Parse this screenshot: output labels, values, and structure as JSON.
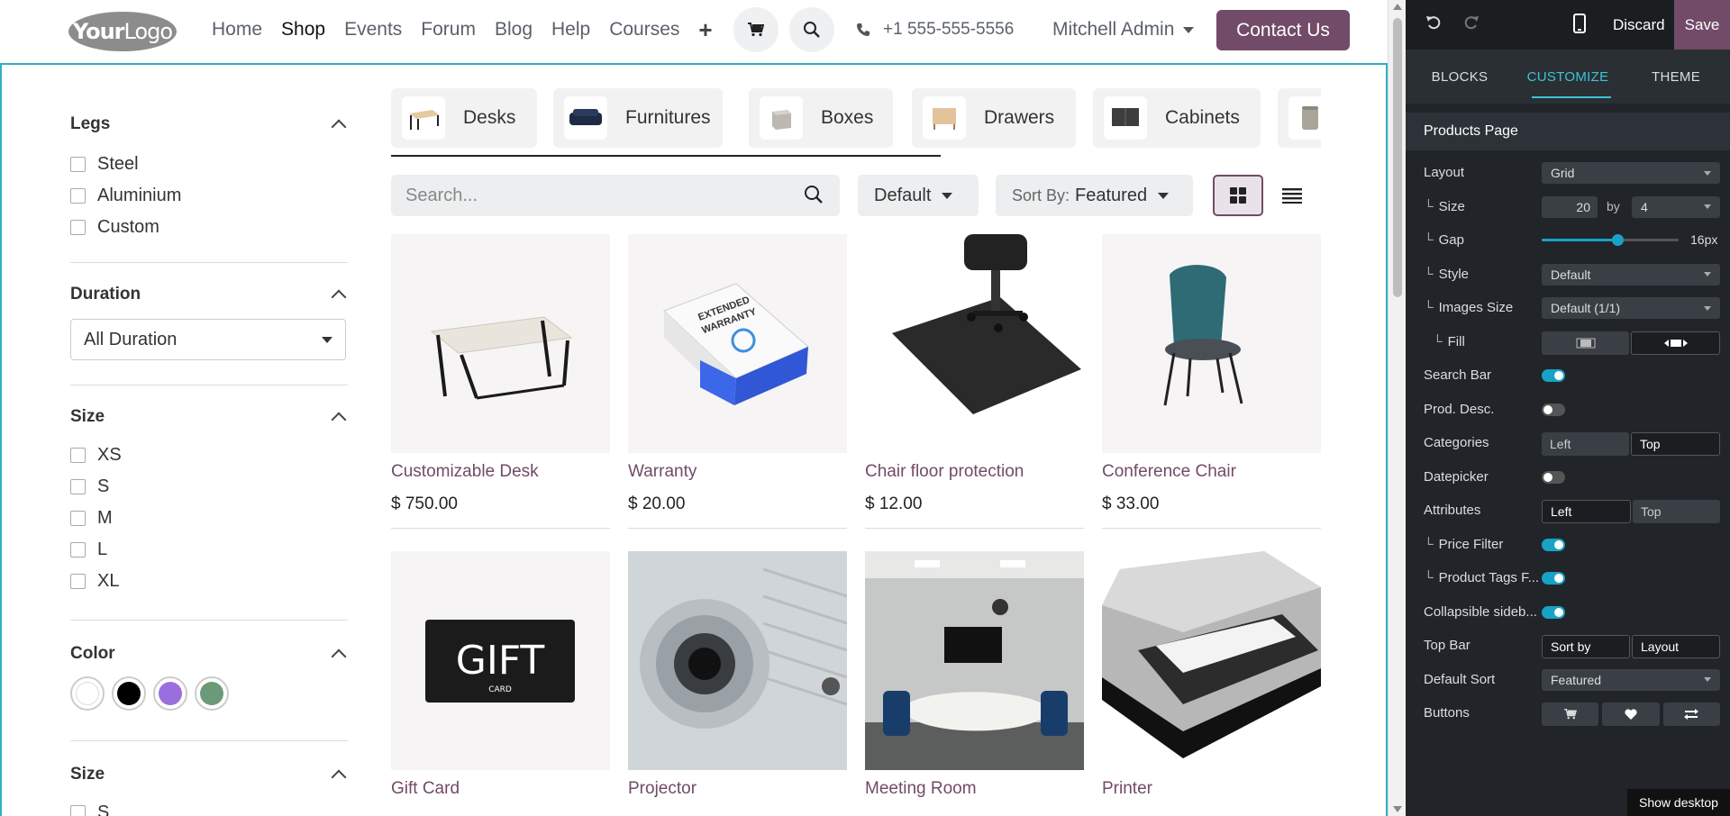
{
  "header": {
    "logo_your": "Your",
    "logo_logo": "Logo",
    "nav": [
      "Home",
      "Shop",
      "Events",
      "Forum",
      "Blog",
      "Help",
      "Courses"
    ],
    "nav_plus": "+",
    "phone": "+1 555-555-5556",
    "user": "Mitchell Admin",
    "contact_label": "Contact Us"
  },
  "filters": {
    "legs": {
      "title": "Legs",
      "options": [
        "Steel",
        "Aluminium",
        "Custom"
      ]
    },
    "duration": {
      "title": "Duration",
      "value": "All Duration"
    },
    "size": {
      "title": "Size",
      "options": [
        "XS",
        "S",
        "M",
        "L",
        "XL"
      ]
    },
    "color": {
      "title": "Color",
      "swatches": [
        "#ffffff",
        "#000000",
        "#9b6ee0",
        "#6a9a78"
      ]
    },
    "size2": {
      "title": "Size",
      "options": [
        "S"
      ]
    }
  },
  "categories": [
    "Desks",
    "Furnitures",
    "Boxes",
    "Drawers",
    "Cabinets"
  ],
  "toolbar": {
    "search_placeholder": "Search...",
    "pricelist": "Default",
    "sort_prefix": "Sort By:",
    "sort_value": "Featured"
  },
  "products": [
    {
      "name": "Customizable Desk",
      "price": "$ 750.00"
    },
    {
      "name": "Warranty",
      "price": "$ 20.00"
    },
    {
      "name": "Chair floor protection",
      "price": "$ 12.00"
    },
    {
      "name": "Conference Chair",
      "price": "$ 33.00"
    },
    {
      "name": "Gift Card",
      "price": ""
    },
    {
      "name": "Projector",
      "price": ""
    },
    {
      "name": "Meeting Room",
      "price": ""
    },
    {
      "name": "Printer",
      "price": ""
    }
  ],
  "gift_card": {
    "big": "GIFT",
    "small": "CARD"
  },
  "editor": {
    "discard": "Discard",
    "save": "Save",
    "tabs": [
      "BLOCKS",
      "CUSTOMIZE",
      "THEME"
    ],
    "section": "Products Page",
    "layout": {
      "label": "Layout",
      "value": "Grid"
    },
    "size": {
      "label": "Size",
      "value": "20",
      "by": "by",
      "cols": "4"
    },
    "gap": {
      "label": "Gap",
      "value": "16px",
      "level": 0.55
    },
    "style": {
      "label": "Style",
      "value": "Default"
    },
    "images_size": {
      "label": "Images Size",
      "value": "Default (1/1)"
    },
    "fill": {
      "label": "Fill"
    },
    "search_bar": {
      "label": "Search Bar",
      "on": true
    },
    "prod_desc": {
      "label": "Prod. Desc.",
      "on": false
    },
    "categories": {
      "label": "Categories",
      "opt_a": "Left",
      "opt_b": "Top"
    },
    "datepicker": {
      "label": "Datepicker",
      "on": false
    },
    "attributes": {
      "label": "Attributes",
      "opt_a": "Left",
      "opt_b": "Top"
    },
    "price_filter": {
      "label": "Price Filter",
      "on": true
    },
    "tags_filter": {
      "label": "Product Tags F...",
      "on": true
    },
    "collapsible": {
      "label": "Collapsible sideb...",
      "on": true
    },
    "top_bar": {
      "label": "Top Bar",
      "opt_a": "Sort by",
      "opt_b": "Layout"
    },
    "default_sort": {
      "label": "Default Sort",
      "value": "Featured"
    },
    "buttons": {
      "label": "Buttons"
    },
    "show_desktop": "Show desktop"
  }
}
